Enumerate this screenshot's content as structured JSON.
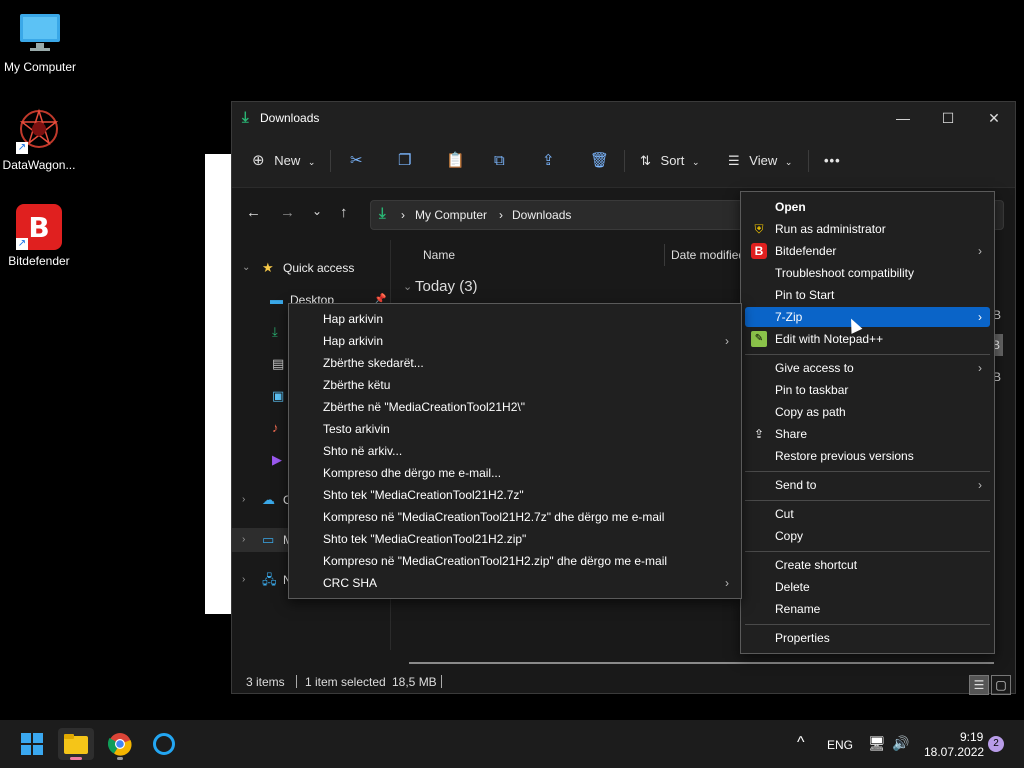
{
  "desktop": {
    "icons": [
      {
        "label": "My Computer"
      },
      {
        "label": "DataWagon..."
      },
      {
        "label": "Bitdefender"
      }
    ]
  },
  "explorer": {
    "title": "Downloads",
    "toolbar": {
      "new": "New",
      "sort": "Sort",
      "view": "View",
      "more": "•••"
    },
    "breadcrumb": {
      "root": "My Computer",
      "current": "Downloads"
    },
    "sidebar": {
      "quick_access": "Quick access",
      "desktop": "Desktop",
      "onedrive_letter": "O",
      "mycomputer_letter": "M",
      "network_letter": "N"
    },
    "columns": {
      "name": "Name",
      "date": "Date modified"
    },
    "group_label": "Today (3)",
    "status": {
      "items": "3 items",
      "selected": "1 item selected",
      "size": "18,5 MB"
    }
  },
  "menu_main": {
    "items": [
      {
        "label": "Open",
        "bold": true
      },
      {
        "label": "Run as administrator",
        "icon": "shield-icon"
      },
      {
        "label": "Bitdefender",
        "icon": "bitdefender-icon",
        "submenu": true
      },
      {
        "label": "Troubleshoot compatibility"
      },
      {
        "label": "Pin to Start"
      },
      {
        "label": "7-Zip",
        "submenu": true,
        "highlighted": true
      },
      {
        "label": "Edit with Notepad++",
        "icon": "notepadpp-icon"
      },
      {
        "label": "Give access to",
        "submenu": true
      },
      {
        "label": "Pin to taskbar"
      },
      {
        "label": "Copy as path"
      },
      {
        "label": "Share",
        "icon": "share-icon"
      },
      {
        "label": "Restore previous versions"
      },
      {
        "label": "Send to",
        "submenu": true
      },
      {
        "label": "Cut"
      },
      {
        "label": "Copy"
      },
      {
        "label": "Create shortcut"
      },
      {
        "label": "Delete"
      },
      {
        "label": "Rename"
      },
      {
        "label": "Properties"
      }
    ]
  },
  "menu_7zip": {
    "items": [
      {
        "label": "Hap arkivin"
      },
      {
        "label": "Hap arkivin",
        "submenu": true
      },
      {
        "label": "Zbërthe skedarët..."
      },
      {
        "label": "Zbërthe këtu"
      },
      {
        "label": "Zbërthe në \"MediaCreationTool21H2\\\""
      },
      {
        "label": "Testo arkivin"
      },
      {
        "label": "Shto në arkiv..."
      },
      {
        "label": "Kompreso dhe dërgo me e-mail..."
      },
      {
        "label": "Shto tek \"MediaCreationTool21H2.7z\""
      },
      {
        "label": "Kompreso në \"MediaCreationTool21H2.7z\" dhe dërgo me e-mail"
      },
      {
        "label": "Shto tek \"MediaCreationTool21H2.zip\""
      },
      {
        "label": "Kompreso në \"MediaCreationTool21H2.zip\" dhe dërgo me e-mail"
      },
      {
        "label": "CRC SHA",
        "submenu": true
      }
    ]
  },
  "partial_letters": {
    "b1": "B",
    "b2": "B",
    "b3": "B"
  },
  "taskbar": {
    "lang": "ENG",
    "time": "9:19",
    "date": "18.07.2022",
    "notifications": "2"
  },
  "colors": {
    "accent": "#0a64c8",
    "download_green": "#29b473"
  }
}
